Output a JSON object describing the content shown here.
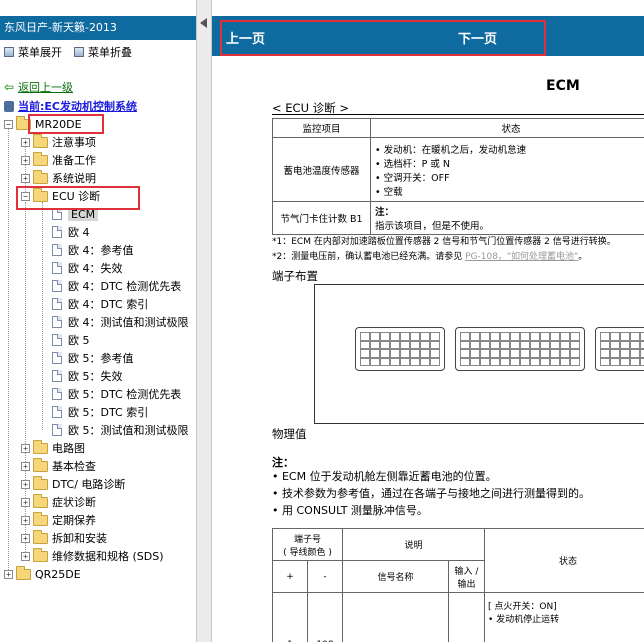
{
  "left": {
    "title": "东风日产-新天籁-2013",
    "toolbar": {
      "expand_label": "菜单展开",
      "collapse_label": "菜单折叠"
    },
    "back_link": "返回上一级",
    "current_link": "当前:EC发动机控制系统",
    "tree": {
      "mr20de": "MR20DE",
      "notes": "注意事项",
      "prep": "准备工作",
      "sys": "系统说明",
      "ecu": "ECU 诊断",
      "ecu_children": [
        "ECM",
        "欧 4",
        "欧 4：参考值",
        "欧 4：失效",
        "欧 4：DTC 检测优先表",
        "欧 4：DTC 索引",
        "欧 4：测试值和测试极限",
        "欧 5",
        "欧 5：参考值",
        "欧 5：失效",
        "欧 5：DTC 检测优先表",
        "欧 5：DTC 索引",
        "欧 5：测试值和测试极限"
      ],
      "after": [
        "电路图",
        "基本检查",
        "DTC/ 电路诊断",
        "症状诊断",
        "定期保养",
        "拆卸和安装",
        "维修数据和规格 (SDS)"
      ],
      "qr25de": "QR25DE"
    }
  },
  "right": {
    "prev": "上一页",
    "next": "下一页",
    "doc_title": "ECM",
    "subtitle": "< ECU 诊断 >",
    "table1": {
      "h1": "监控项目",
      "h2": "状态",
      "r1_item": "蓄电池温度传感器",
      "r1_conds": [
        "发动机：在暖机之后，发动机怠速",
        "选档杆：P 或 N",
        "空调开关：OFF",
        "空载"
      ],
      "r2_item": "节气门卡住计数 B1",
      "r2_note_title": "注：",
      "r2_note": "指示该项目，但是不使用。"
    },
    "note1": "*1：ECM 在内部对加速踏板位置传感器 2 信号和节气门位置传感器 2 信号进行转换。",
    "note2_prefix": "*2：测量电压前，确认蓄电池已经充满。请参见 ",
    "note2_ref": "PG-108，\"如何处理蓄电池\"",
    "note2_suffix": "。",
    "terminal_layout": "端子布置",
    "phys_title": "物理值",
    "phys_note": "注：",
    "phys_items": [
      "• ECM 位于发动机舱左侧靠近蓄电池的位置。",
      "• 技术参数为参考值，通过在各端子与接地之间进行测量得到的。",
      "• 用 CONSULT 测量脉冲信号。"
    ],
    "table2": {
      "terminal": "端子号\n( 导线颜色 )",
      "desc": "说明",
      "state": "状态",
      "plus": "+",
      "minus": "-",
      "signal": "信号名称",
      "io": "输入 / 输出",
      "row1_plus": "1",
      "row1_minus": "108",
      "row1_state": "[ 点火开关：ON]",
      "row1_state2": "• 发动机停止运转"
    }
  }
}
